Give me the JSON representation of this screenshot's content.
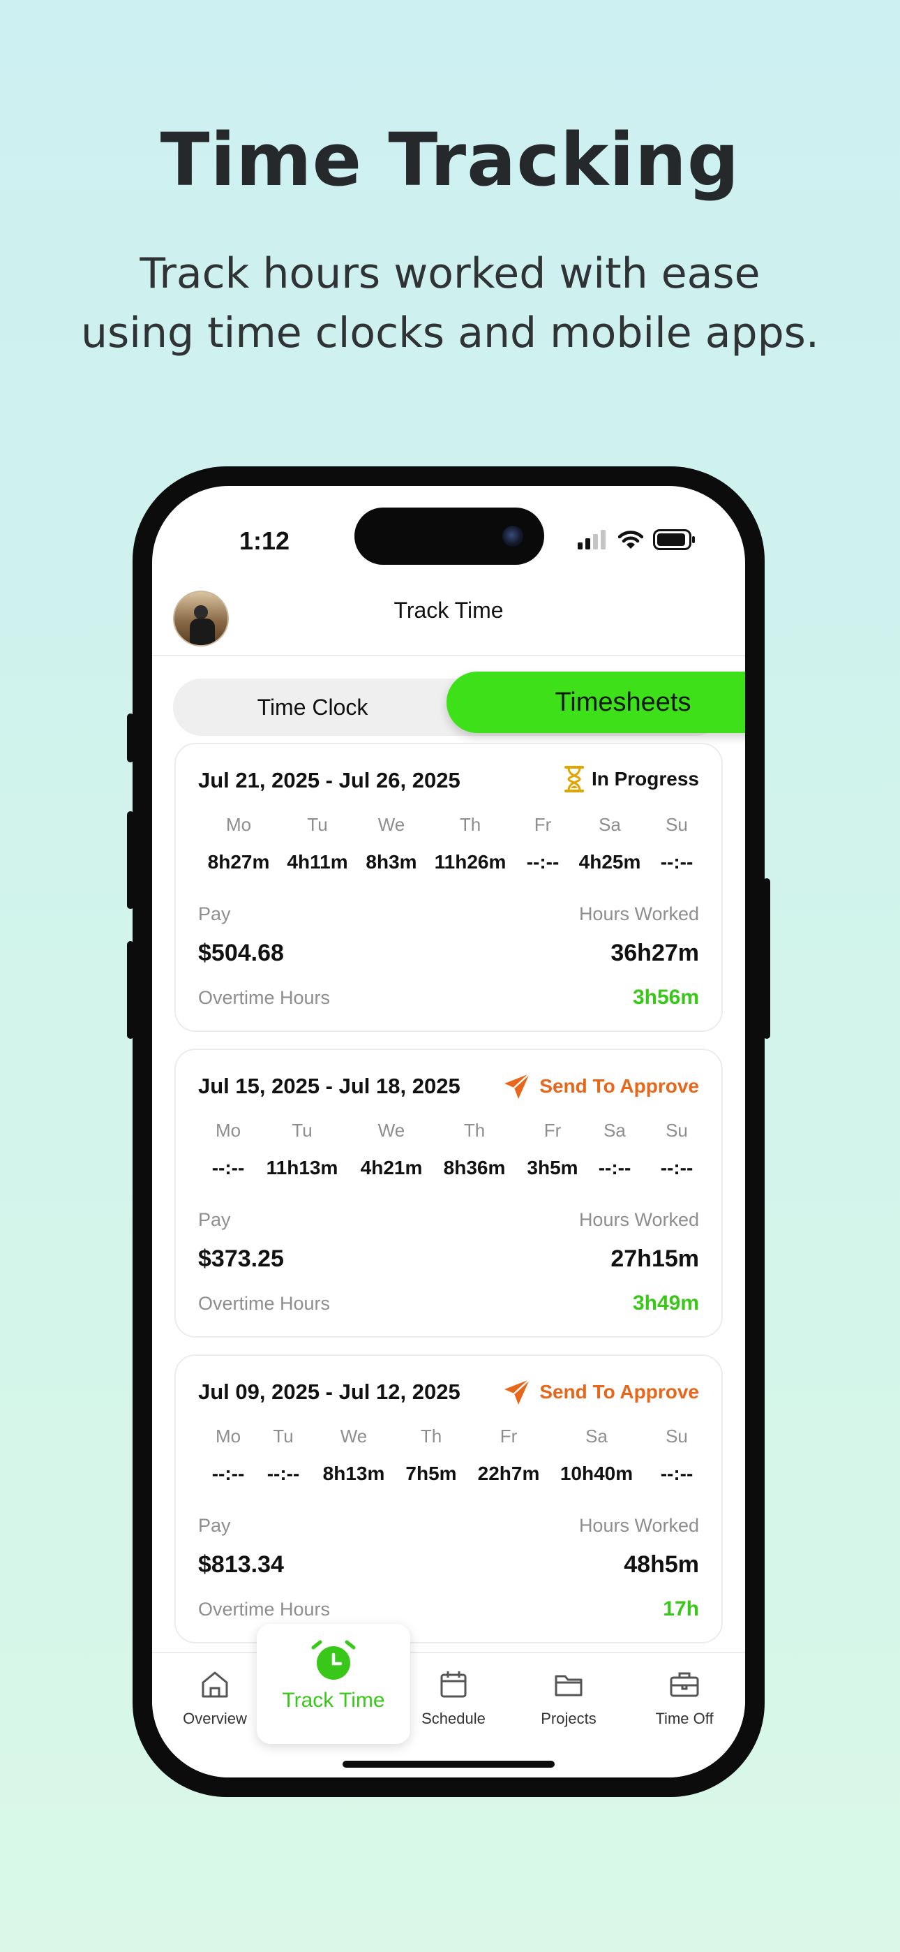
{
  "promo": {
    "headline": "Time Tracking",
    "subhead": "Track hours worked with ease\nusing time clocks and mobile apps."
  },
  "status_bar": {
    "time": "1:12"
  },
  "header": {
    "title": "Track Time"
  },
  "toggle": {
    "left": "Time Clock",
    "right": "Timesheets",
    "selected": "Timesheets"
  },
  "labels": {
    "pay": "Pay",
    "hours_worked": "Hours Worked",
    "overtime": "Overtime Hours"
  },
  "timesheets": [
    {
      "range": "Jul 21, 2025 - Jul 26, 2025",
      "status": "In Progress",
      "status_icon": "hourglass-icon",
      "days": [
        {
          "d": "Mo",
          "v": "8h27m"
        },
        {
          "d": "Tu",
          "v": "4h11m"
        },
        {
          "d": "We",
          "v": "8h3m"
        },
        {
          "d": "Th",
          "v": "11h26m"
        },
        {
          "d": "Fr",
          "v": "--:--"
        },
        {
          "d": "Sa",
          "v": "4h25m"
        },
        {
          "d": "Su",
          "v": "--:--"
        }
      ],
      "pay": "$504.68",
      "hours_worked": "36h27m",
      "overtime": "3h56m"
    },
    {
      "range": "Jul 15, 2025 - Jul 18, 2025",
      "status": "Send To Approve",
      "status_icon": "send-icon",
      "days": [
        {
          "d": "Mo",
          "v": "--:--"
        },
        {
          "d": "Tu",
          "v": "11h13m"
        },
        {
          "d": "We",
          "v": "4h21m"
        },
        {
          "d": "Th",
          "v": "8h36m"
        },
        {
          "d": "Fr",
          "v": "3h5m"
        },
        {
          "d": "Sa",
          "v": "--:--"
        },
        {
          "d": "Su",
          "v": "--:--"
        }
      ],
      "pay": "$373.25",
      "hours_worked": "27h15m",
      "overtime": "3h49m"
    },
    {
      "range": "Jul 09, 2025 - Jul 12, 2025",
      "status": "Send To Approve",
      "status_icon": "send-icon",
      "days": [
        {
          "d": "Mo",
          "v": "--:--"
        },
        {
          "d": "Tu",
          "v": "--:--"
        },
        {
          "d": "We",
          "v": "8h13m"
        },
        {
          "d": "Th",
          "v": "7h5m"
        },
        {
          "d": "Fr",
          "v": "22h7m"
        },
        {
          "d": "Sa",
          "v": "10h40m"
        },
        {
          "d": "Su",
          "v": "--:--"
        }
      ],
      "pay": "$813.34",
      "hours_worked": "48h5m",
      "overtime": "17h"
    }
  ],
  "nav": {
    "items": [
      {
        "label": "Overview",
        "icon": "home-icon"
      },
      {
        "label": "Track Time",
        "icon": "alarm-clock-icon",
        "active": true
      },
      {
        "label": "Schedule",
        "icon": "calendar-icon"
      },
      {
        "label": "Projects",
        "icon": "folder-icon"
      },
      {
        "label": "Time Off",
        "icon": "briefcase-icon"
      }
    ]
  },
  "colors": {
    "accent_green": "#3ee01a",
    "overtime_green": "#39c81a",
    "in_progress_icon": "#e2a400",
    "send_orange": "#e8661a"
  }
}
